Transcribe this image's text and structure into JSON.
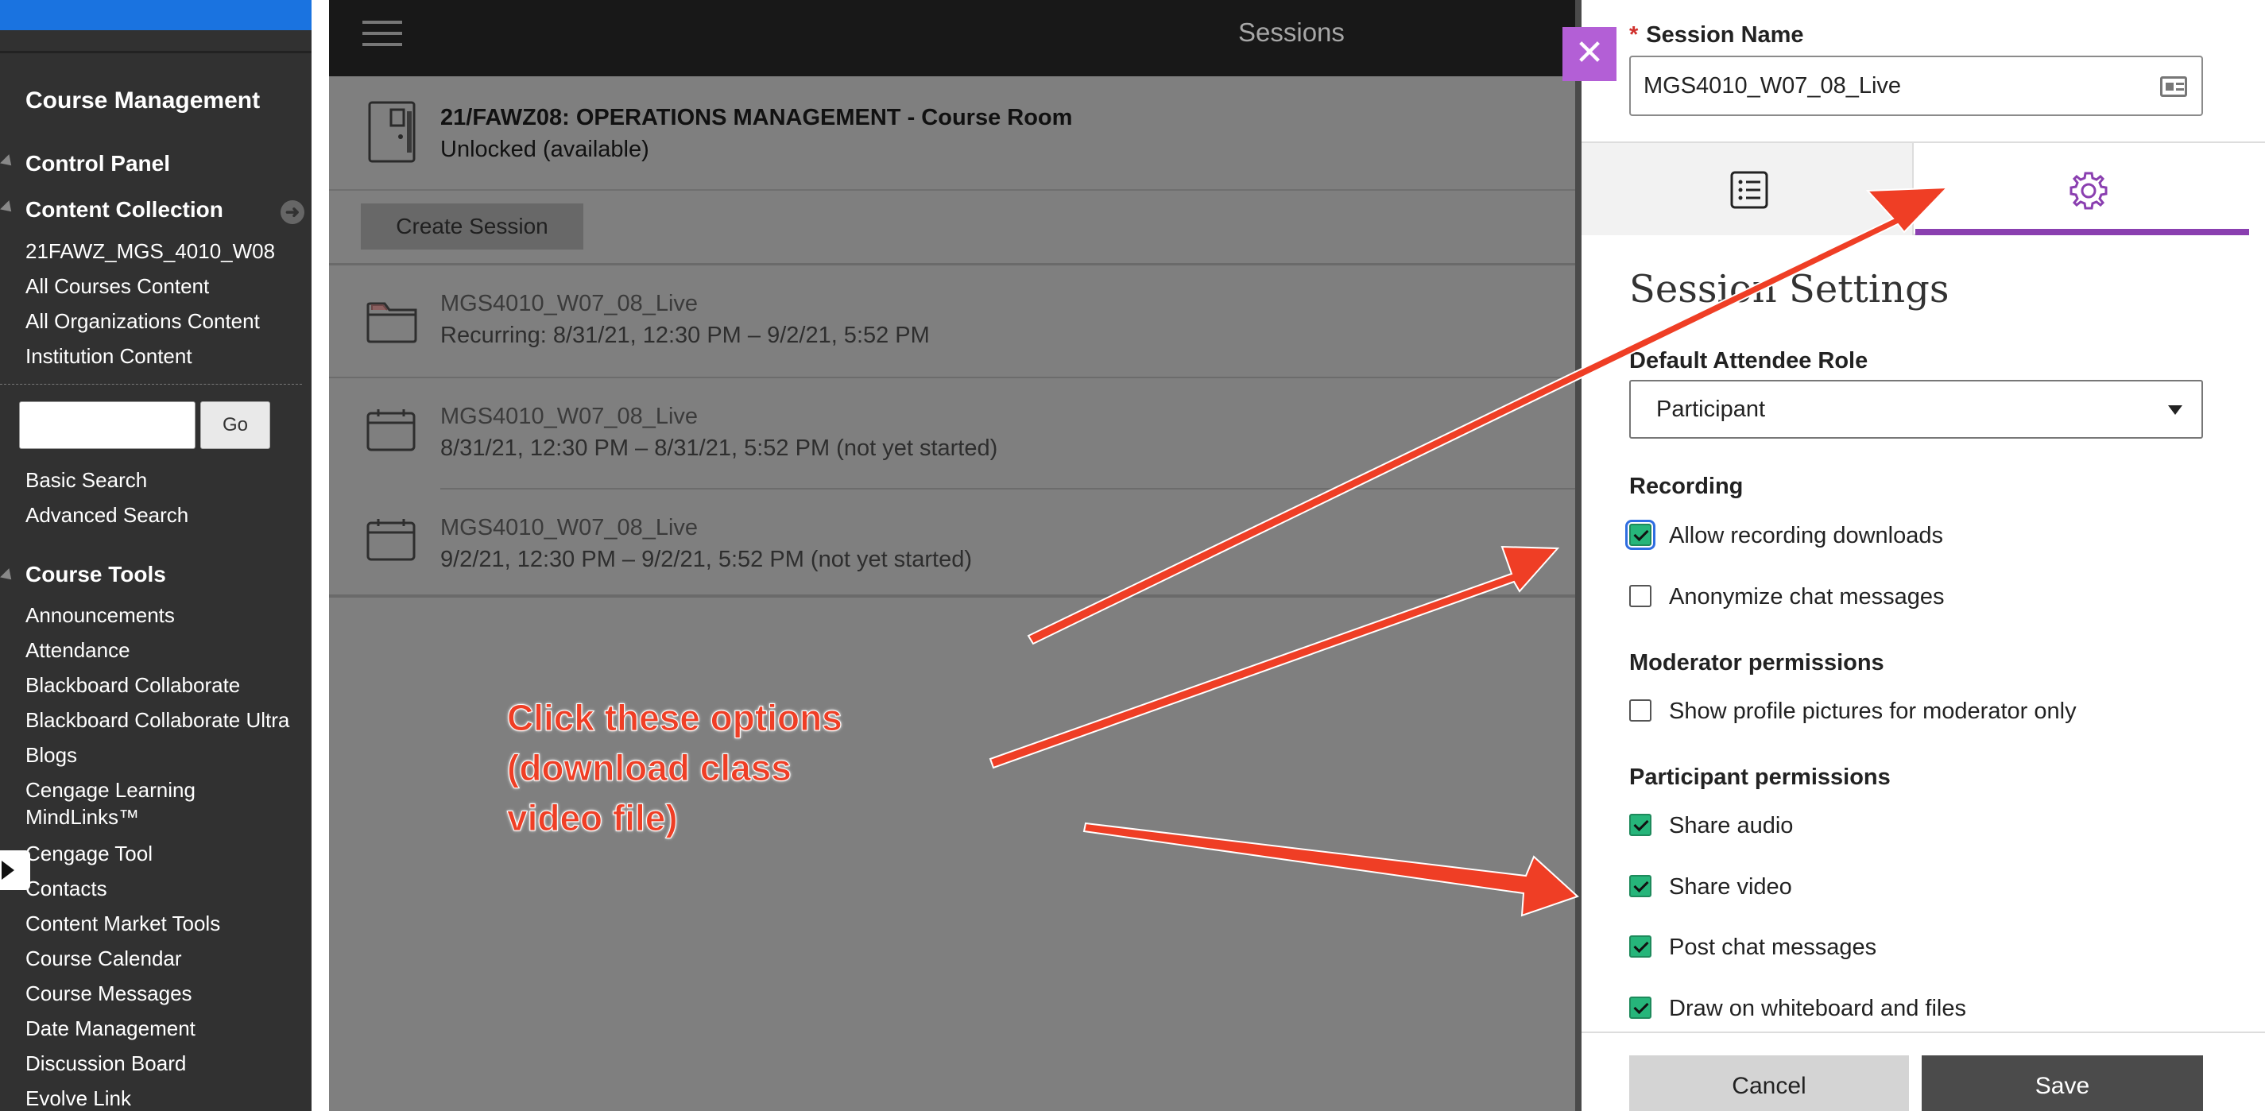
{
  "left_menu": {
    "course_management": "Course Management",
    "control_panel": "Control Panel",
    "content_collection": "Content Collection",
    "collection_links": [
      "21FAWZ_MGS_4010_W08",
      "All Courses Content",
      "All Organizations Content",
      "Institution Content"
    ],
    "search_go": "Go",
    "search_links": [
      "Basic Search",
      "Advanced Search"
    ],
    "course_tools": "Course Tools",
    "tools": [
      "Announcements",
      "Attendance",
      "Blackboard Collaborate",
      "Blackboard Collaborate Ultra",
      "Blogs",
      "Cengage Learning",
      "MindLinks™",
      "Cengage Tool",
      "Contacts",
      "Content Market Tools",
      "Course Calendar",
      "Course Messages",
      "Date Management",
      "Discussion Board",
      "Evolve Link"
    ]
  },
  "sessions": {
    "title": "Sessions",
    "room_title": "21/FAWZ08: OPERATIONS MANAGEMENT - Course Room",
    "room_status": "Unlocked (available)",
    "create_label": "Create Session",
    "rows": [
      {
        "name": "MGS4010_W07_08_Live",
        "date": "Recurring: 8/31/21, 12:30 PM – 9/2/21, 5:52 PM",
        "icon": "folder-icon"
      },
      {
        "name": "MGS4010_W07_08_Live",
        "date": "8/31/21, 12:30 PM – 8/31/21, 5:52 PM (not yet started)",
        "icon": "calendar-icon"
      },
      {
        "name": "MGS4010_W07_08_Live",
        "date": "9/2/21, 12:30 PM – 9/2/21, 5:52 PM (not yet started)",
        "icon": "calendar-icon"
      }
    ]
  },
  "panel": {
    "close": "✕",
    "session_name_label": "Session Name",
    "required_marker": "*",
    "session_name_value": "MGS4010_W07_08_Live",
    "settings_heading": "Session Settings",
    "role_label": "Default Attendee Role",
    "role_value": "Participant",
    "recording_label": "Recording",
    "recording_options": [
      {
        "label": "Allow recording downloads",
        "checked": true
      },
      {
        "label": "Anonymize chat messages",
        "checked": false
      }
    ],
    "moderator_label": "Moderator permissions",
    "moderator_options": [
      {
        "label": "Show profile pictures for moderator only",
        "checked": false
      }
    ],
    "participant_label": "Participant permissions",
    "participant_options": [
      {
        "label": "Share audio",
        "checked": true
      },
      {
        "label": "Share video",
        "checked": true
      },
      {
        "label": "Post chat messages",
        "checked": true
      },
      {
        "label": "Draw on whiteboard and files",
        "checked": true
      }
    ],
    "cancel": "Cancel",
    "save": "Save"
  },
  "annotation": {
    "text": "Click these options\n(download class\nvideo file)",
    "color": "#ef3e25"
  },
  "colors": {
    "accent_purple": "#8a3fb0",
    "check_green": "#26b57a",
    "top_blue": "#1a73e0"
  }
}
